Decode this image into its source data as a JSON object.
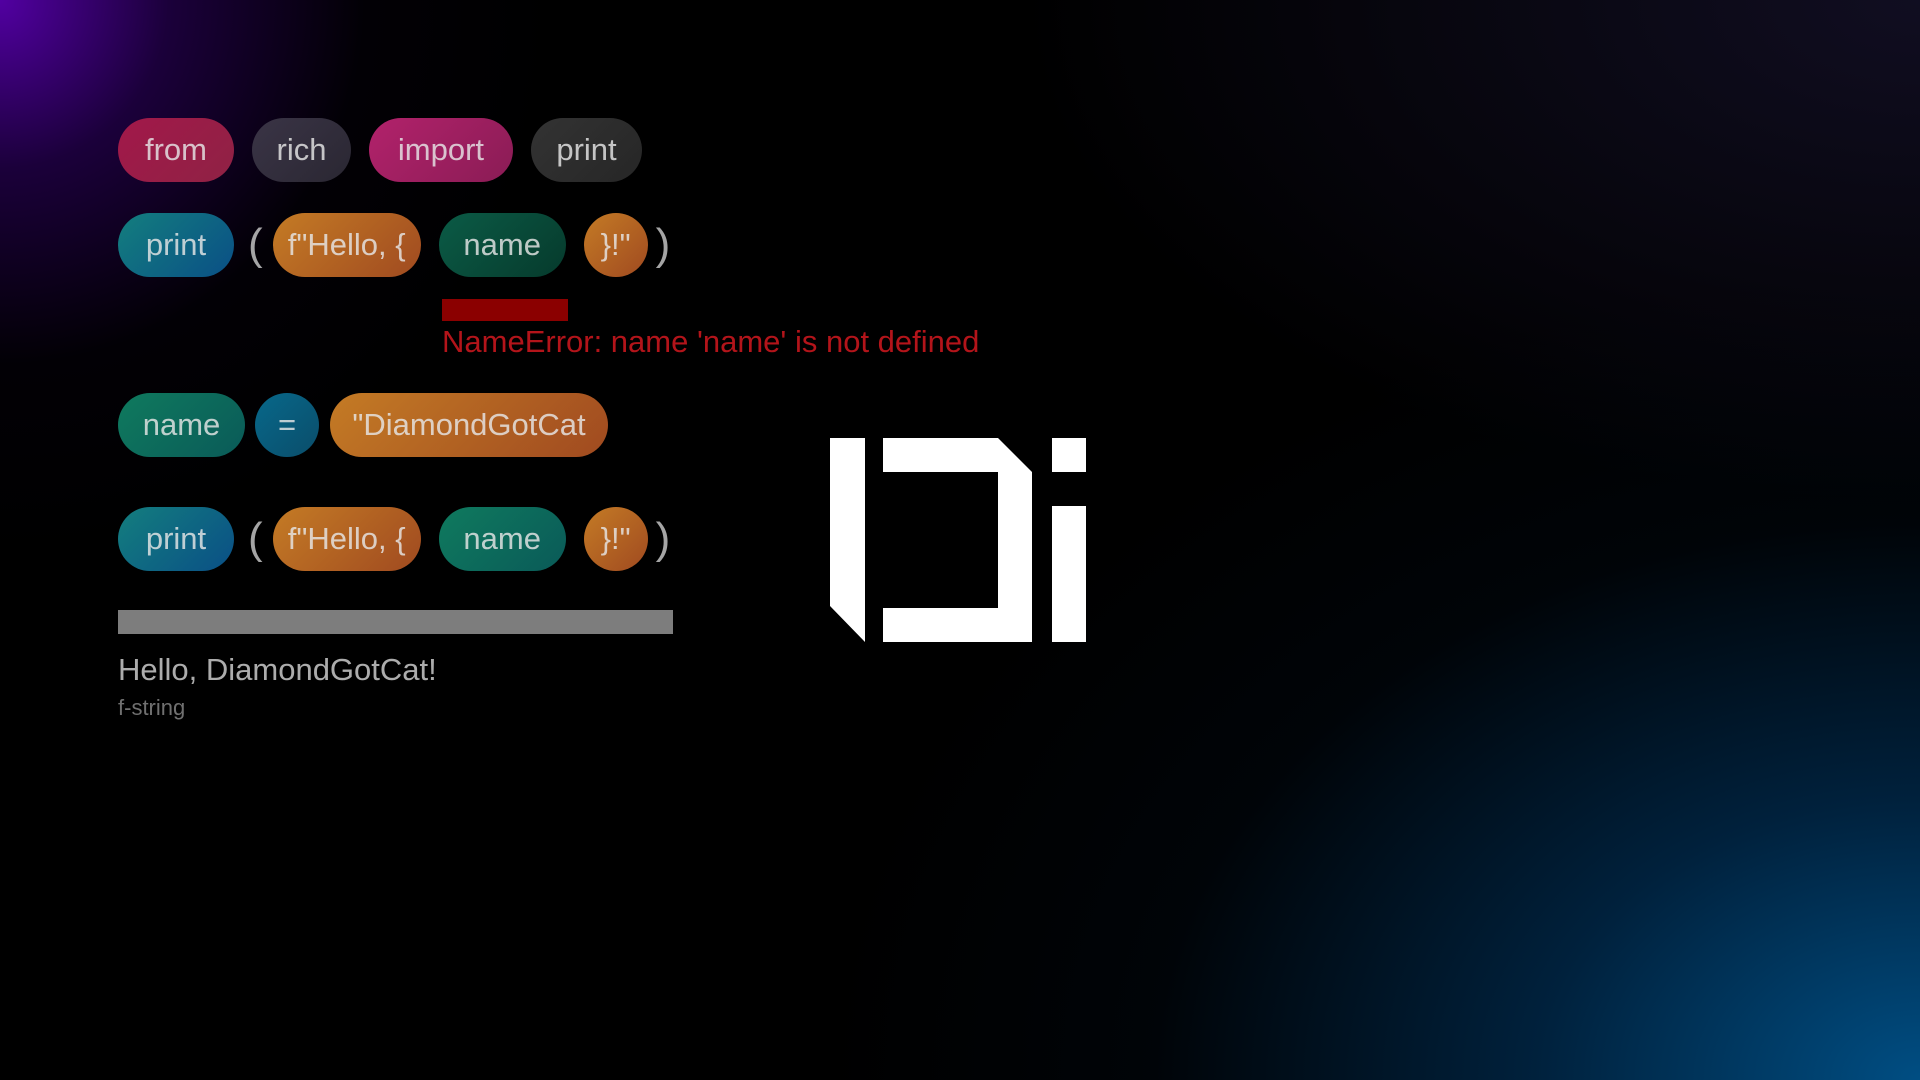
{
  "lines": [
    {
      "tokens": [
        "from",
        "rich",
        "import",
        "print"
      ]
    },
    {
      "tokens": [
        "print",
        "(",
        "f\"Hello, {",
        "name",
        "}!\"",
        ")"
      ]
    },
    {
      "tokens": [
        "name",
        "=",
        "\"DiamondGotCat"
      ]
    },
    {
      "tokens": [
        "print",
        "(",
        "f\"Hello, {",
        "name",
        "}!\"",
        ")"
      ]
    }
  ],
  "error": {
    "message": "NameError: name 'name' is not defined",
    "color": "#b3141a"
  },
  "output": {
    "text": "Hello, DiamondGotCat!",
    "caption": "f-string"
  },
  "logo": {
    "icon": "di-logo-icon",
    "color": "#ffffff"
  },
  "colors": {
    "background_top_left": "#5a00b4",
    "background_bottom_right": "#00528a",
    "error": "#8b0000"
  }
}
